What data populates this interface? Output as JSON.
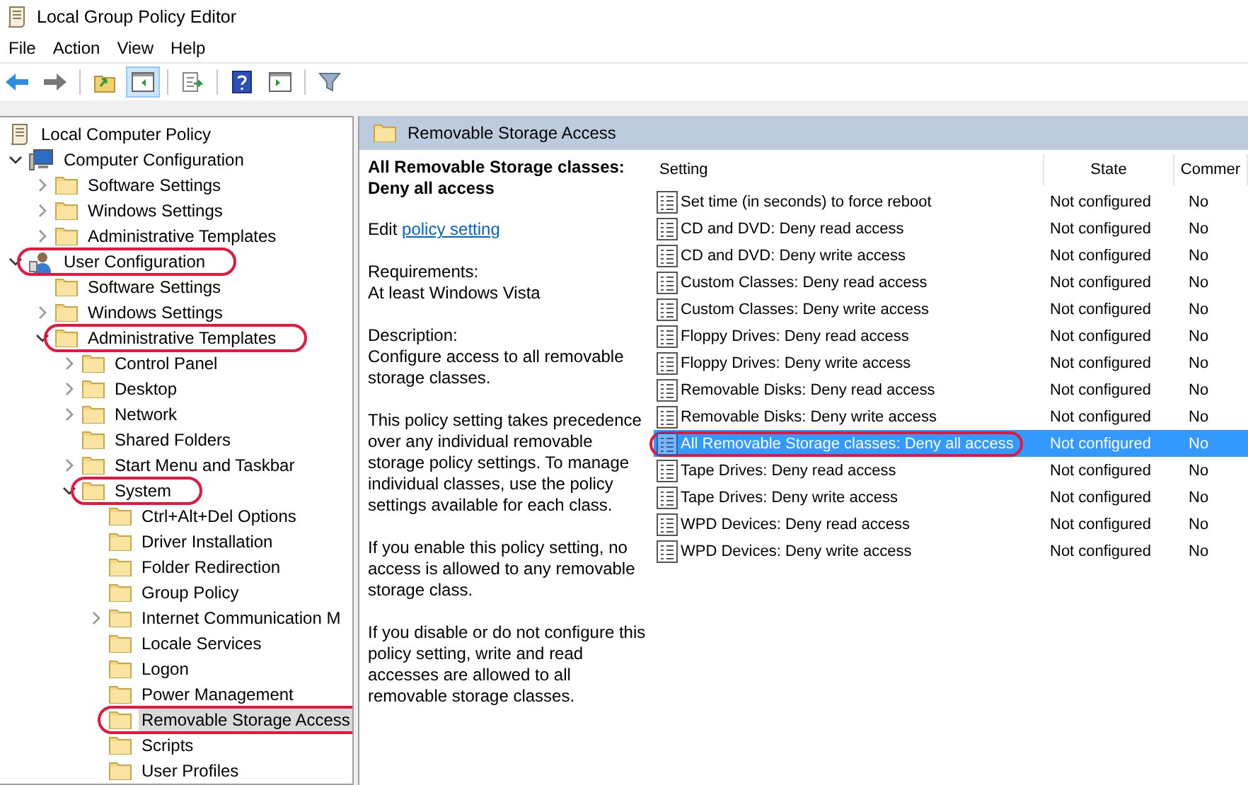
{
  "window": {
    "title": "Local Group Policy Editor"
  },
  "menu": [
    "File",
    "Action",
    "View",
    "Help"
  ],
  "toolbar": [
    [
      {
        "kind": "back",
        "pressed": false
      },
      {
        "kind": "forward",
        "pressed": false
      }
    ],
    [
      {
        "kind": "up",
        "pressed": false
      },
      {
        "kind": "tree",
        "pressed": true
      }
    ],
    [
      {
        "kind": "export",
        "pressed": false
      }
    ],
    [
      {
        "kind": "help",
        "pressed": false
      },
      {
        "kind": "pane",
        "pressed": false
      }
    ],
    [
      {
        "kind": "filter",
        "pressed": false
      }
    ]
  ],
  "tree": [
    {
      "label": "Local Computer Policy",
      "kind": "scroll",
      "selected": false,
      "circled": false,
      "children": [
        {
          "label": "Computer Configuration",
          "kind": "computer",
          "expanded": true,
          "selected": false,
          "circled": false,
          "children": [
            {
              "label": "Software Settings",
              "kind": "folder",
              "expanded": false,
              "selected": false,
              "circled": false
            },
            {
              "label": "Windows Settings",
              "kind": "folder",
              "expanded": false,
              "selected": false,
              "circled": false
            },
            {
              "label": "Administrative Templates",
              "kind": "folder",
              "expanded": false,
              "selected": false,
              "circled": false
            }
          ]
        },
        {
          "label": "User Configuration",
          "kind": "user",
          "expanded": true,
          "selected": false,
          "circled": true,
          "children": [
            {
              "label": "Software Settings",
              "kind": "folder",
              "selected": false,
              "circled": false
            },
            {
              "label": "Windows Settings",
              "kind": "folder",
              "expanded": false,
              "selected": false,
              "circled": false
            },
            {
              "label": "Administrative Templates",
              "kind": "folder",
              "expanded": true,
              "selected": false,
              "circled": true,
              "children": [
                {
                  "label": "Control Panel",
                  "kind": "folder",
                  "expanded": false,
                  "selected": false,
                  "circled": false
                },
                {
                  "label": "Desktop",
                  "kind": "folder",
                  "expanded": false,
                  "selected": false,
                  "circled": false
                },
                {
                  "label": "Network",
                  "kind": "folder",
                  "expanded": false,
                  "selected": false,
                  "circled": false
                },
                {
                  "label": "Shared Folders",
                  "kind": "folder",
                  "selected": false,
                  "circled": false
                },
                {
                  "label": "Start Menu and Taskbar",
                  "kind": "folder",
                  "expanded": false,
                  "selected": false,
                  "circled": false
                },
                {
                  "label": "System",
                  "kind": "folder",
                  "expanded": true,
                  "selected": false,
                  "circled": true,
                  "children": [
                    {
                      "label": "Ctrl+Alt+Del Options",
                      "kind": "folder",
                      "selected": false,
                      "circled": false
                    },
                    {
                      "label": "Driver Installation",
                      "kind": "folder",
                      "selected": false,
                      "circled": false
                    },
                    {
                      "label": "Folder Redirection",
                      "kind": "folder",
                      "selected": false,
                      "circled": false
                    },
                    {
                      "label": "Group Policy",
                      "kind": "folder",
                      "selected": false,
                      "circled": false
                    },
                    {
                      "label": "Internet Communication M",
                      "kind": "folder",
                      "expanded": false,
                      "selected": false,
                      "circled": false
                    },
                    {
                      "label": "Locale Services",
                      "kind": "folder",
                      "selected": false,
                      "circled": false
                    },
                    {
                      "label": "Logon",
                      "kind": "folder",
                      "selected": false,
                      "circled": false
                    },
                    {
                      "label": "Power Management",
                      "kind": "folder",
                      "selected": false,
                      "circled": false
                    },
                    {
                      "label": "Removable Storage Access",
                      "kind": "folder",
                      "selected": true,
                      "circled": true
                    },
                    {
                      "label": "Scripts",
                      "kind": "folder",
                      "selected": false,
                      "circled": false
                    },
                    {
                      "label": "User Profiles",
                      "kind": "folder",
                      "selected": false,
                      "circled": false
                    }
                  ]
                }
              ]
            }
          ]
        }
      ]
    }
  ],
  "panel": {
    "title": "Removable Storage Access"
  },
  "description": {
    "title": "All Removable Storage classes: Deny all access",
    "edit_prefix": "Edit",
    "edit_link": "policy setting",
    "requirements_label": "Requirements:",
    "requirements": "At least Windows Vista",
    "description_label": "Description:",
    "paragraphs": [
      "Configure access to all removable storage classes.",
      "This policy setting takes precedence over any individual removable storage policy settings. To manage individual classes, use the policy settings available for each class.",
      "If you enable this policy setting, no access is allowed to any removable storage class.",
      "If you disable or do not configure this policy setting, write and read accesses are allowed to all removable storage classes."
    ]
  },
  "list": {
    "columns": [
      "Setting",
      "State",
      "Commer"
    ],
    "rows": [
      {
        "setting": "Set time (in seconds) to force reboot",
        "state": "Not configured",
        "comment": "No",
        "selected": false,
        "circled": false
      },
      {
        "setting": "CD and DVD: Deny read access",
        "state": "Not configured",
        "comment": "No",
        "selected": false,
        "circled": false
      },
      {
        "setting": "CD and DVD: Deny write access",
        "state": "Not configured",
        "comment": "No",
        "selected": false,
        "circled": false
      },
      {
        "setting": "Custom Classes: Deny read access",
        "state": "Not configured",
        "comment": "No",
        "selected": false,
        "circled": false
      },
      {
        "setting": "Custom Classes: Deny write access",
        "state": "Not configured",
        "comment": "No",
        "selected": false,
        "circled": false
      },
      {
        "setting": "Floppy Drives: Deny read access",
        "state": "Not configured",
        "comment": "No",
        "selected": false,
        "circled": false
      },
      {
        "setting": "Floppy Drives: Deny write access",
        "state": "Not configured",
        "comment": "No",
        "selected": false,
        "circled": false
      },
      {
        "setting": "Removable Disks: Deny read access",
        "state": "Not configured",
        "comment": "No",
        "selected": false,
        "circled": false
      },
      {
        "setting": "Removable Disks: Deny write access",
        "state": "Not configured",
        "comment": "No",
        "selected": false,
        "circled": false
      },
      {
        "setting": "All Removable Storage classes: Deny all access",
        "state": "Not configured",
        "comment": "No",
        "selected": true,
        "circled": true
      },
      {
        "setting": "Tape Drives: Deny read access",
        "state": "Not configured",
        "comment": "No",
        "selected": false,
        "circled": false
      },
      {
        "setting": "Tape Drives: Deny write access",
        "state": "Not configured",
        "comment": "No",
        "selected": false,
        "circled": false
      },
      {
        "setting": "WPD Devices: Deny read access",
        "state": "Not configured",
        "comment": "No",
        "selected": false,
        "circled": false
      },
      {
        "setting": "WPD Devices: Deny write access",
        "state": "Not configured",
        "comment": "No",
        "selected": false,
        "circled": false
      }
    ]
  }
}
